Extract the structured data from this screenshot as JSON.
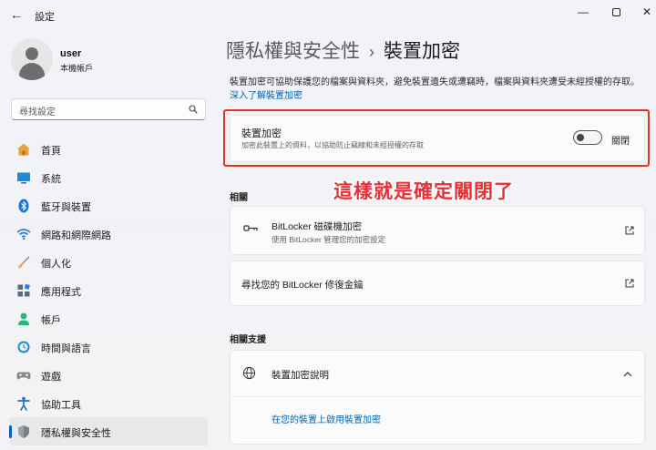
{
  "window": {
    "title": "設定",
    "back_icon": "back-arrow-icon",
    "controls": [
      "minimize-icon",
      "maximize-icon",
      "close-icon"
    ]
  },
  "profile": {
    "name": "user",
    "account_type": "本機帳戶"
  },
  "search": {
    "placeholder": "尋找設定"
  },
  "sidebar": {
    "items": [
      {
        "label": "首頁",
        "icon": "home-icon"
      },
      {
        "label": "系統",
        "icon": "system-icon"
      },
      {
        "label": "藍牙與裝置",
        "icon": "bluetooth-icon"
      },
      {
        "label": "網路和網際網路",
        "icon": "wifi-icon"
      },
      {
        "label": "個人化",
        "icon": "brush-icon"
      },
      {
        "label": "應用程式",
        "icon": "apps-icon"
      },
      {
        "label": "帳戶",
        "icon": "account-icon"
      },
      {
        "label": "時間與語言",
        "icon": "time-language-icon"
      },
      {
        "label": "遊戲",
        "icon": "gamepad-icon"
      },
      {
        "label": "協助工具",
        "icon": "accessibility-icon"
      },
      {
        "label": "隱私權與安全性",
        "icon": "shield-icon",
        "active": true
      }
    ]
  },
  "breadcrumb": {
    "parent": "隱私權與安全性",
    "separator": "›",
    "current": "裝置加密"
  },
  "description": {
    "text": "裝置加密可協助保護您的檔案與資料夾，避免裝置遺失或遭竊時，檔案與資料夾遭受未經授權的存取。",
    "link": "深入了解裝置加密"
  },
  "encryption": {
    "title": "裝置加密",
    "subtitle": "加密此裝置上的資料，以協助防止竊線和未經授權的存取",
    "state_label": "關閉",
    "enabled": false
  },
  "annotation": "這樣就是確定關閉了",
  "related": {
    "heading": "相關",
    "bitlocker_title": "BitLocker 磁碟機加密",
    "bitlocker_sub": "使用 BitLocker 管理您的加密設定",
    "recovery_title": "尋找您的 BitLocker 修復金鑰"
  },
  "support": {
    "heading": "相關支援",
    "help_title": "裝置加密說明",
    "help_link": "在您的裝置上啟用裝置加密"
  },
  "colors": {
    "accent": "#005fb8",
    "link": "#0063b1",
    "annotation": "#ea2e35"
  }
}
